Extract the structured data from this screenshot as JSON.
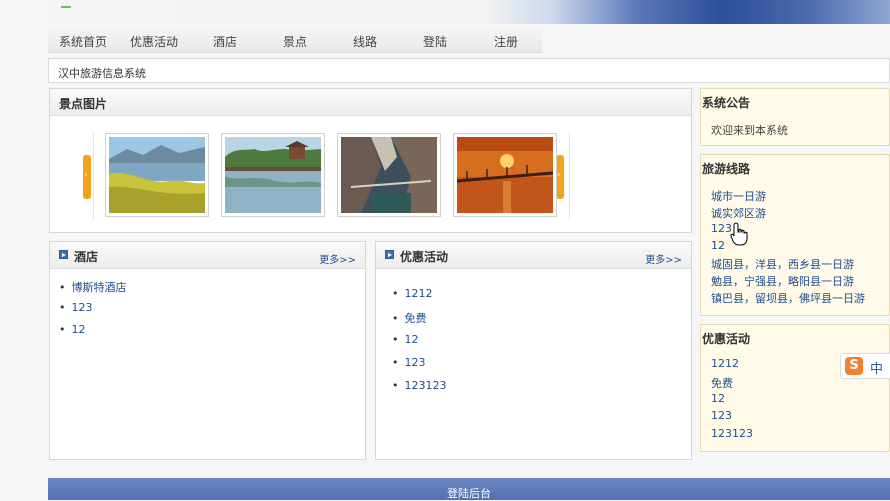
{
  "nav": {
    "items": [
      "系统首页",
      "优惠活动",
      "酒店",
      "景点",
      "线路",
      "登陆",
      "注册"
    ]
  },
  "breadcrumb": "汉中旅游信息系统",
  "scenic": {
    "title": "景点图片",
    "photos": [
      "rapeseed-lake",
      "river-pavilion",
      "mountain-cliff",
      "sunset-bridge"
    ]
  },
  "hotel": {
    "title": "酒店",
    "more": "更多>>",
    "items": [
      "博斯特酒店",
      "123",
      "12"
    ]
  },
  "promo": {
    "title": "优惠活动",
    "more": "更多>>",
    "items": [
      "1212",
      "免费",
      "12",
      "123",
      "123123"
    ]
  },
  "notice": {
    "title": "系统公告",
    "text": "欢迎来到本系统"
  },
  "routes": {
    "title": "旅游线路",
    "items": [
      "城市一日游",
      "诚实郊区游",
      "123",
      "12",
      "城固县，洋县，西乡县一日游",
      "勉县，宁强县，略阳县一日游",
      "镇巴县，留坝县，佛坪县一日游"
    ]
  },
  "side_promo": {
    "title": "优惠活动",
    "items": [
      "1212",
      "免费",
      "12",
      "123",
      "123123"
    ]
  },
  "footer": {
    "label": "登陆后台"
  },
  "ime": {
    "logo": "S",
    "lang": "中"
  },
  "colors": {
    "accent_orange": "#f3a21b",
    "link_blue": "#1f4c8f",
    "footer_blue": "#5a74b6",
    "side_bg": "#fffbe8"
  }
}
